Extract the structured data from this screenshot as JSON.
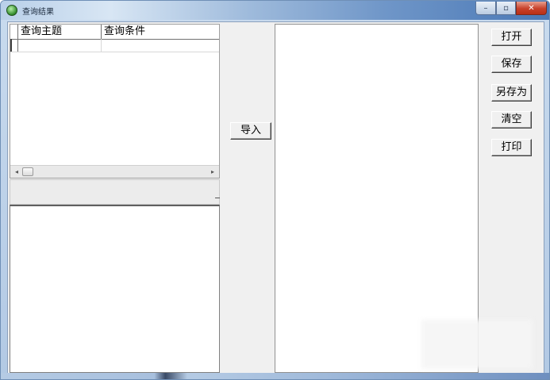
{
  "window": {
    "title": "查询结果",
    "controls": {
      "minimize": "–",
      "maximize": "▫",
      "close": "✕"
    }
  },
  "grid": {
    "columns": [
      "查询主题",
      "查询条件"
    ],
    "scroll": {
      "left": "◂",
      "right": "▸"
    }
  },
  "buttons": {
    "import": "导入",
    "open": "打开",
    "save": "保存",
    "save_as": "另存为",
    "clear": "清空",
    "print": "打印"
  },
  "icons": {
    "app": "app-icon",
    "minimize": "minimize-icon",
    "maximize": "maximize-icon",
    "close": "close-icon"
  }
}
